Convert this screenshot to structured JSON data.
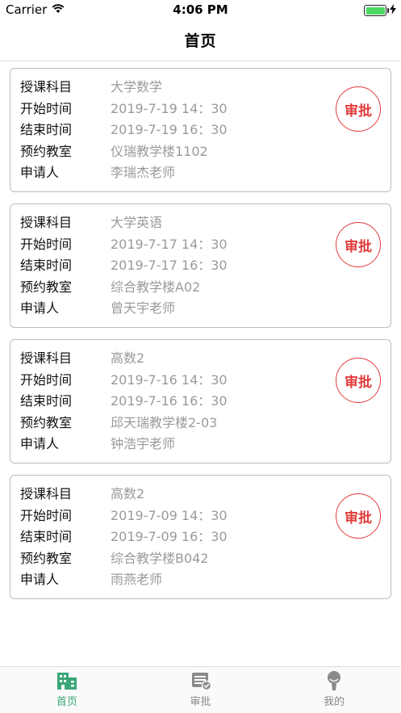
{
  "status_bar": {
    "carrier": "Carrier",
    "time": "4:06 PM"
  },
  "nav": {
    "title": "首页"
  },
  "labels": {
    "subject": "授课科目",
    "start": "开始时间",
    "end": "结束时间",
    "room": "预约教室",
    "applicant": "申请人",
    "approve": "审批"
  },
  "requests": [
    {
      "subject": "大学数学",
      "start": "2019-7-19 14：30",
      "end": "2019-7-19 16：30",
      "room": "仪瑞教学楼1102",
      "applicant": "李瑞杰老师"
    },
    {
      "subject": "大学英语",
      "start": "2019-7-17 14：30",
      "end": "2019-7-17 16：30",
      "room": "综合教学楼A02",
      "applicant": "曾天宇老师"
    },
    {
      "subject": "高数2",
      "start": "2019-7-16 14：30",
      "end": "2019-7-16 16：30",
      "room": "邱天瑞教学楼2-03",
      "applicant": "钟浩宇老师"
    },
    {
      "subject": "高数2",
      "start": "2019-7-09 14：30",
      "end": "2019-7-09 16：30",
      "room": "综合教学楼B042",
      "applicant": "雨燕老师"
    }
  ],
  "tabs": [
    {
      "label": "首页",
      "icon": "building-icon",
      "active": true
    },
    {
      "label": "审批",
      "icon": "approval-icon",
      "active": false
    },
    {
      "label": "我的",
      "icon": "profile-icon",
      "active": false
    }
  ],
  "colors": {
    "accent_green": "#3aa676",
    "approve_red": "#e23b3b",
    "value_gray": "#9a9a9a",
    "battery_green": "#4cd964"
  }
}
